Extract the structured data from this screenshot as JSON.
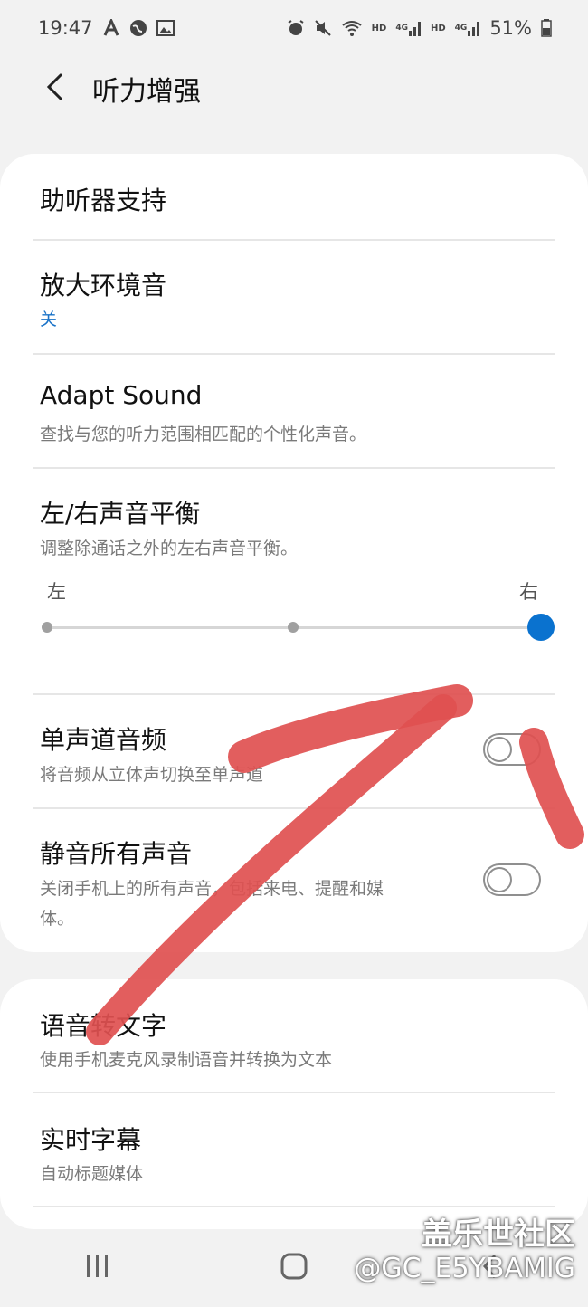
{
  "status_bar": {
    "time": "19:47",
    "left_icons": [
      "font-a-icon",
      "globe-icon",
      "image-icon"
    ],
    "right_icons": [
      "alarm-icon",
      "mute-icon",
      "wifi-icon",
      "signal-icon",
      "signal-icon"
    ],
    "hd1": "HD",
    "hd2": "HD",
    "net1": "4G",
    "net2": "4G",
    "battery": "51%"
  },
  "header": {
    "title": "听力增强"
  },
  "card1": {
    "items": [
      {
        "title": "助听器支持"
      },
      {
        "title": "放大环境音",
        "subtitle": "关"
      },
      {
        "title": "Adapt Sound",
        "subtitle": "查找与您的听力范围相匹配的个性化声音。"
      },
      {
        "title": "左/右声音平衡",
        "subtitle": "调整除通话之外的左右声音平衡。"
      },
      {
        "title": "单声道音频",
        "subtitle": "将音频从立体声切换至单声道",
        "toggle": false
      },
      {
        "title": "静音所有声音",
        "subtitle_line1": "关闭手机上的所有声音，包括来电、提醒和媒",
        "subtitle_line2": "体。",
        "toggle": false
      }
    ],
    "balance": {
      "left_label": "左",
      "right_label": "右",
      "value_fraction": 1.0
    }
  },
  "card2": {
    "items": [
      {
        "title": "语音转文字",
        "subtitle": "使用手机麦克风录制语音并转换为文本"
      },
      {
        "title": "实时字幕",
        "subtitle": "自动标题媒体"
      }
    ]
  },
  "watermark": {
    "line1": "盖乐世社区",
    "line2": "@GC_E5YBAMIG"
  },
  "colors": {
    "accent": "#0a72cf",
    "annotation": "#e05050",
    "background": "#f2f2f2"
  }
}
